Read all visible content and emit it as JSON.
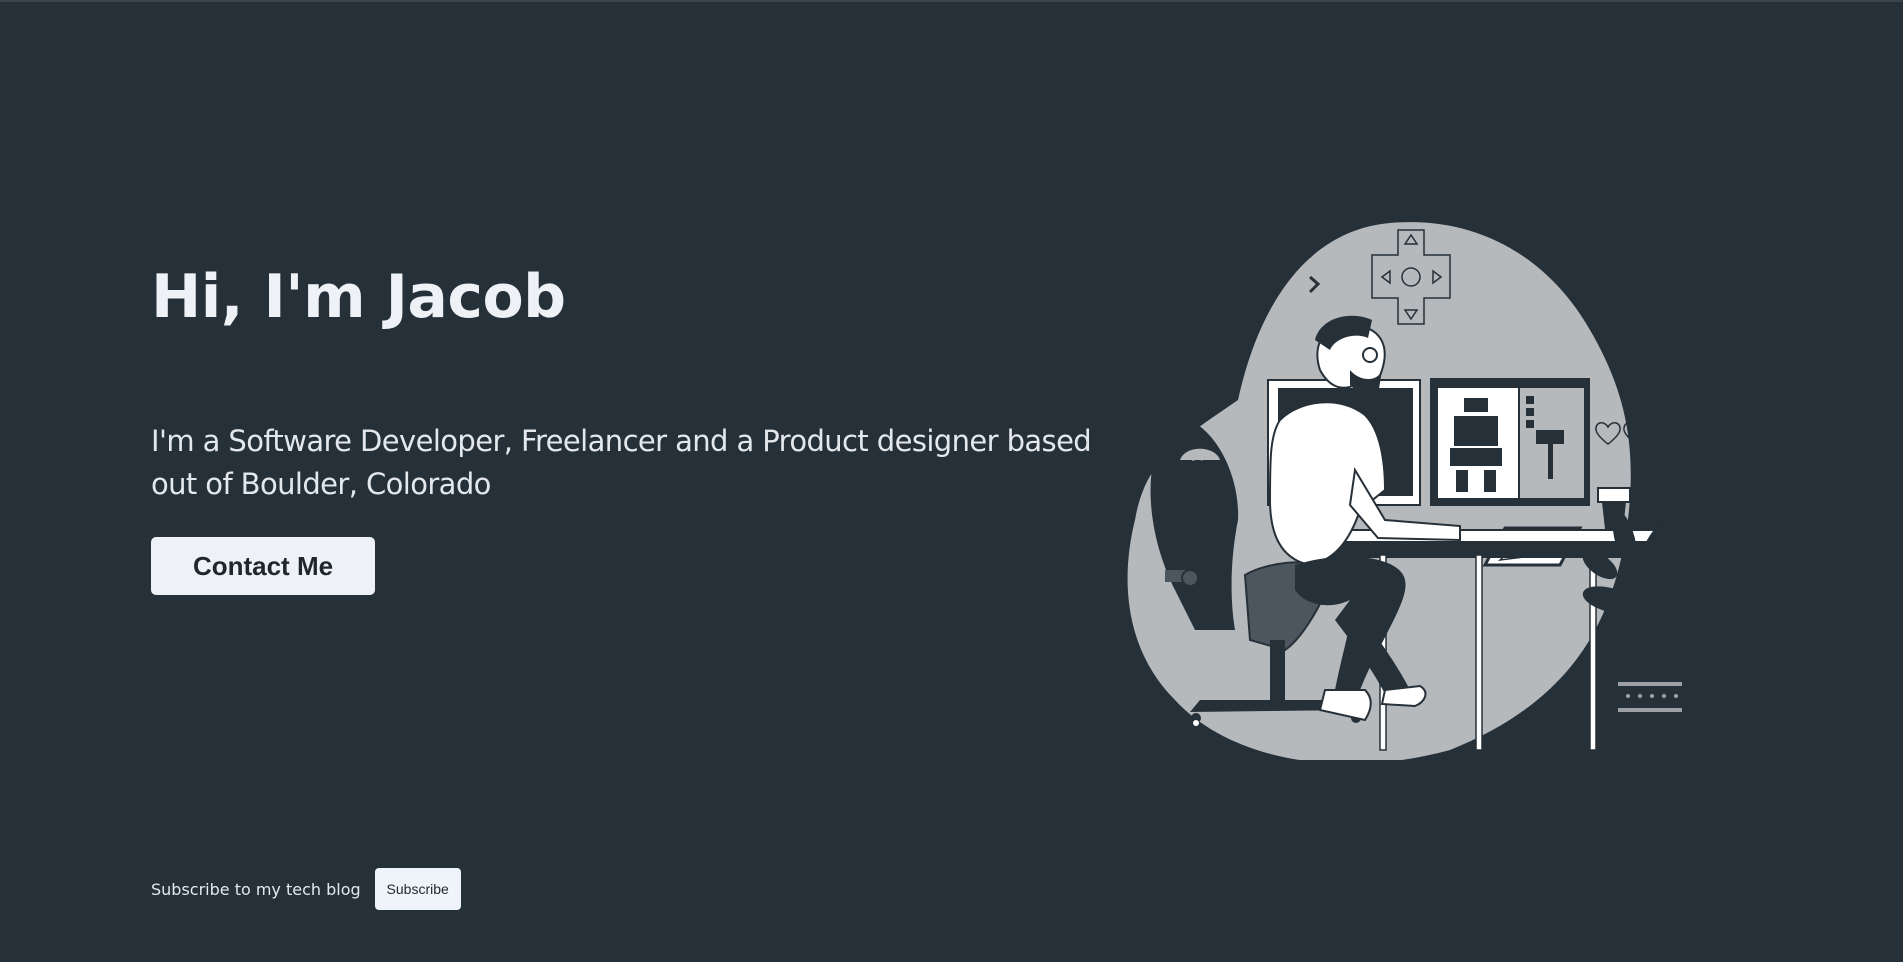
{
  "hero": {
    "title": "Hi, I'm Jacob",
    "description": "I'm a Software Developer, Freelancer and a Product designer based out of Boulder, Colorado",
    "contact_label": "Contact Me"
  },
  "footer": {
    "subscribe_text": "Subscribe to my tech blog",
    "subscribe_label": "Subscribe"
  },
  "colors": {
    "background": "#263038",
    "text": "#eef2f6",
    "button_bg": "#eef2f6",
    "illustration_blob": "#b6b9bc"
  },
  "illustration": {
    "icon": "developer-at-desk-illustration"
  }
}
